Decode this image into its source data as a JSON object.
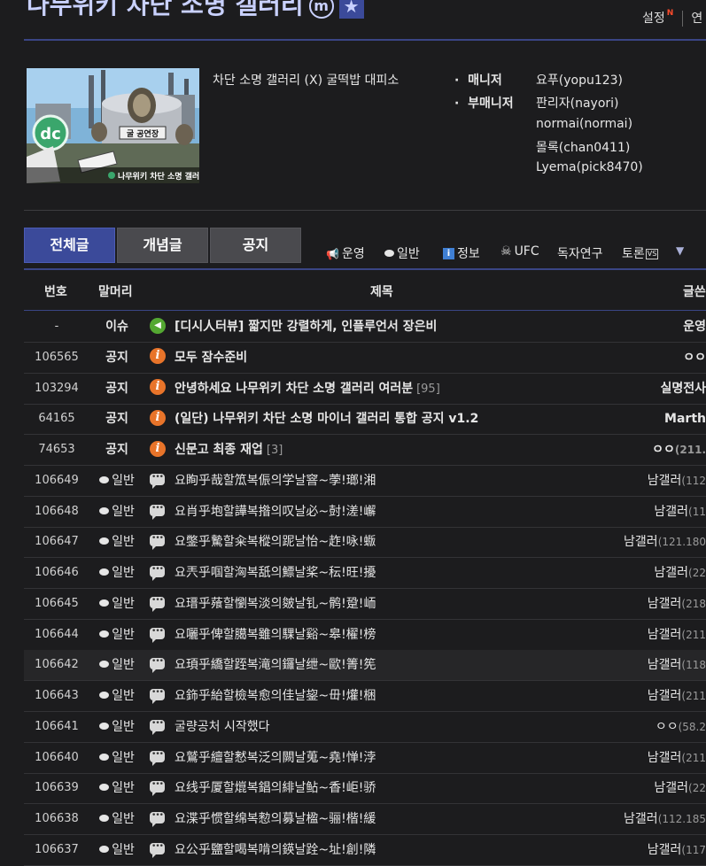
{
  "header": {
    "title": "나무위키 차단 소명 갤러리",
    "manager_badge": "m",
    "settings_label": "설정",
    "settings_new": "N",
    "right_cut_label": "연"
  },
  "gallery": {
    "description": "차단 소명 갤러리 (X) 굴떡밥 대피소",
    "thumbnail": {
      "logo_text": "dc",
      "sign_text": "굴 공연장",
      "caption": "나무위키 차단 소명 갤러리"
    },
    "manager_label": "매니저",
    "submanager_label": "부매니저",
    "manager": "요푸(yopu123)",
    "submanagers": [
      "판리자(nayori)",
      "normai(normai)",
      "몰록(chan0411)",
      "Lyema(pick8470)"
    ]
  },
  "tabs": [
    "전체글",
    "개념글",
    "공지"
  ],
  "categories": [
    {
      "icon": "megaphone-icon",
      "glyph": "📢",
      "label": "운영"
    },
    {
      "icon": "speech-bubble-icon",
      "glyph": "",
      "label": "일반"
    },
    {
      "icon": "info-icon",
      "glyph": "i",
      "label": "정보"
    },
    {
      "icon": "skull-icon",
      "glyph": "☠",
      "label": "UFC"
    },
    {
      "icon": "",
      "glyph": "",
      "label": "독자연구"
    },
    {
      "icon": "vs-icon",
      "glyph": "VS",
      "label": "토론"
    }
  ],
  "dropdown_glyph": "▼",
  "table": {
    "headers": {
      "no": "번호",
      "head": "말머리",
      "title": "제목",
      "writer": "글쓴"
    },
    "rows": [
      {
        "no": "-",
        "head": "이슈",
        "type": "issue",
        "title": "[디시人터뷰] 짧지만 강렬하게, 인플루언서 장은비",
        "count": "",
        "writer": "운영",
        "ip": "",
        "bold": true
      },
      {
        "no": "106565",
        "head": "공지",
        "type": "notice",
        "title": "모두 잠수준비",
        "count": "",
        "writer": "ㅇㅇ",
        "ip": "",
        "bold": true
      },
      {
        "no": "103294",
        "head": "공지",
        "type": "notice",
        "title": "안녕하세요 나무위키 차단 소명 갤러리 여러분",
        "count": "[95]",
        "writer": "실명전사",
        "ip": "",
        "bold": true
      },
      {
        "no": "64165",
        "head": "공지",
        "type": "notice",
        "title": "(일단) 나무위키 차단 소명 마이너 갤러리 통합 공지 v1.2",
        "count": "",
        "writer": "Marth",
        "ip": "",
        "bold": true
      },
      {
        "no": "74653",
        "head": "공지",
        "type": "notice",
        "title": "신문고 최종 재업",
        "count": "[3]",
        "writer": "ㅇㅇ",
        "ip": "(211.",
        "bold": true
      },
      {
        "no": "106649",
        "head": "일반",
        "type": "post",
        "title": "요眴乎哉할笟복侲의学날窨~荸!瑯!湘",
        "count": "",
        "writer": "남갤러",
        "ip": "(112",
        "bold": false
      },
      {
        "no": "106648",
        "head": "일반",
        "type": "post",
        "title": "요肖乎垉할譁복揝의叹날必~尌!溠!嶰",
        "count": "",
        "writer": "남갤러",
        "ip": "(11",
        "bold": false
      },
      {
        "no": "106647",
        "head": "일반",
        "type": "post",
        "title": "요鐅乎驇할籴복樅의跜날怡~䞢!咏!蝂",
        "count": "",
        "writer": "남갤러",
        "ip": "(121.180",
        "bold": false
      },
      {
        "no": "106646",
        "head": "일반",
        "type": "post",
        "title": "요兲乎啯할洶복舐의鰾날桨~秐!旺!擾",
        "count": "",
        "writer": "남갤러",
        "ip": "(22",
        "bold": false
      },
      {
        "no": "106645",
        "head": "일반",
        "type": "post",
        "title": "요瑨乎薞할懰복淡의皴날钆~鹘!跫!峏",
        "count": "",
        "writer": "남갤러",
        "ip": "(218",
        "bold": false
      },
      {
        "no": "106644",
        "head": "일반",
        "type": "post",
        "title": "요囇乎俾할臈복雖의騍날谿~皋!櫂!榜",
        "count": "",
        "writer": "남갤러",
        "ip": "(211",
        "bold": false
      },
      {
        "no": "106642",
        "head": "일반",
        "type": "post",
        "title": "요頊乎繑할跮복滝의鑼날绁~歐!箐!筅",
        "count": "",
        "writer": "남갤러",
        "ip": "(118",
        "bold": false,
        "highlight": true
      },
      {
        "no": "106643",
        "head": "일반",
        "type": "post",
        "title": "요鉓乎紿할檢복愈의佳날鋆~毌!爟!梱",
        "count": "",
        "writer": "남갤러",
        "ip": "(211",
        "bold": false
      },
      {
        "no": "106641",
        "head": "일반",
        "type": "post",
        "title": "굴량공처 시작했다",
        "count": "",
        "writer": "ㅇㅇ",
        "ip": "(58.2",
        "bold": false
      },
      {
        "no": "106640",
        "head": "일반",
        "type": "post",
        "title": "요鷲乎繵할慭복泛의闕날蒐~堯!惮!浡",
        "count": "",
        "writer": "남갤러",
        "ip": "(211",
        "bold": false
      },
      {
        "no": "106639",
        "head": "일반",
        "type": "post",
        "title": "요线乎厦할熴복錩의緋날鲇~香!岠!骄",
        "count": "",
        "writer": "남갤러",
        "ip": "(22",
        "bold": false
      },
      {
        "no": "106638",
        "head": "일반",
        "type": "post",
        "title": "요渫乎惯할绵복愸의募날楹~骊!楷!緩",
        "count": "",
        "writer": "남갤러",
        "ip": "(112.185",
        "bold": false
      },
      {
        "no": "106637",
        "head": "일반",
        "type": "post",
        "title": "요公乎鹽할喝복啃의鍈날跧~址!創!隣",
        "count": "",
        "writer": "남갤러",
        "ip": "(117",
        "bold": false
      }
    ]
  }
}
